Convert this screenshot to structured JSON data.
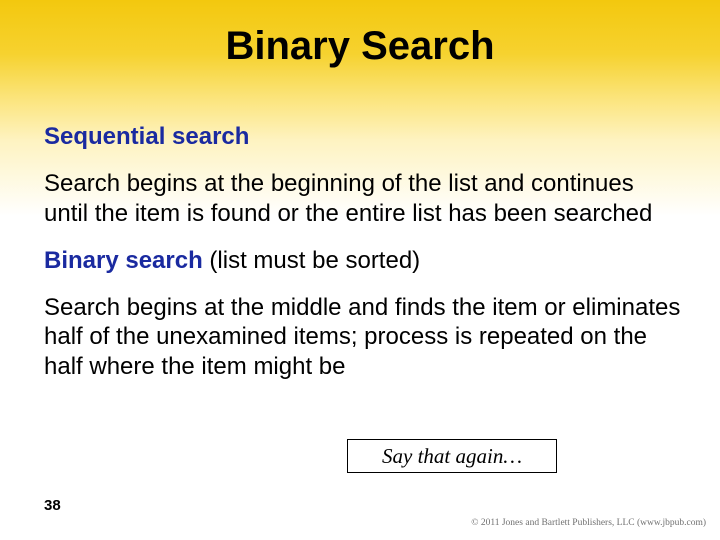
{
  "title": "Binary Search",
  "seq": {
    "heading": "Sequential search",
    "body": "Search begins at the beginning of the list and continues until the item is found or the entire list has been searched"
  },
  "bin": {
    "heading": "Binary search",
    "qualifier": " (list must be sorted)",
    "body": "Search begins at the middle and finds the item or eliminates half of the unexamined items; process is repeated on the half where the item might be"
  },
  "callout": "Say that again…",
  "page_number": "38",
  "copyright": "© 2011 Jones and Bartlett Publishers, LLC (www.jbpub.com)"
}
